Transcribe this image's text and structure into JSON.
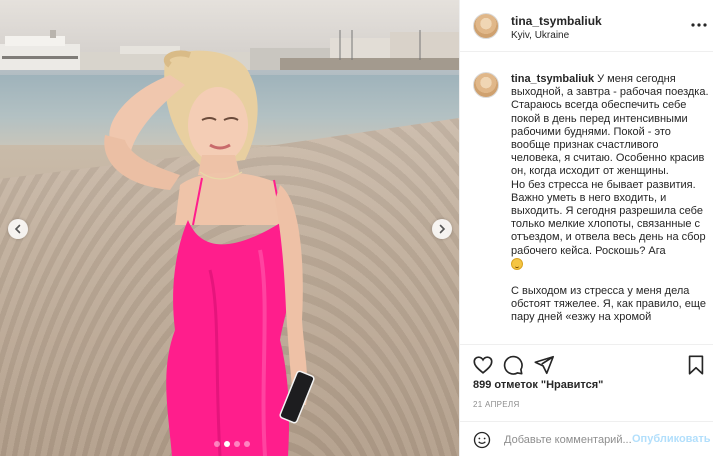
{
  "post": {
    "username": "tina_tsymbaliuk",
    "location": "Kyiv, Ukraine"
  },
  "caption": {
    "username": "tina_tsymbaliuk",
    "paragraphs": [
      "У меня сегодня выходной, а завтра - рабочая поездка. Стараюсь всегда обеспечить себе покой в день перед интенсивными рабочими буднями. Покой - это вообще признак счастливого человека, я считаю. Особенно красив он, когда исходит от женщины.",
      "Но без стресса не бывает развития. Важно уметь в него входить, и выходить. Я сегодня разрешила себе только мелкие хлопоты, связанные с отъездом, и отвела весь день на сбор рабочего кейса. Роскошь? Ага",
      "С выходом из стресса у меня дела обстоят тяжелее. Я, как правило, еще пару дней «езжу на хромой"
    ]
  },
  "stats": {
    "likes": "899 отметок \"Нравится\"",
    "date": "21 АПРЕЛЯ"
  },
  "comment_box": {
    "placeholder": "Добавьте комментарий...",
    "post_label": "Опубликовать"
  },
  "carousel": {
    "slide_count": 4,
    "active_index": 1
  },
  "colors": {
    "post_button_disabled": "#b2dffc",
    "secondary_text": "#8e8e8e",
    "dress": "#ff1e8c"
  },
  "icons": [
    "chevron-left-icon",
    "chevron-right-icon",
    "more-icon",
    "heart-icon",
    "comment-icon",
    "share-icon",
    "bookmark-icon",
    "smiley-icon",
    "emoji-smile-icon"
  ]
}
